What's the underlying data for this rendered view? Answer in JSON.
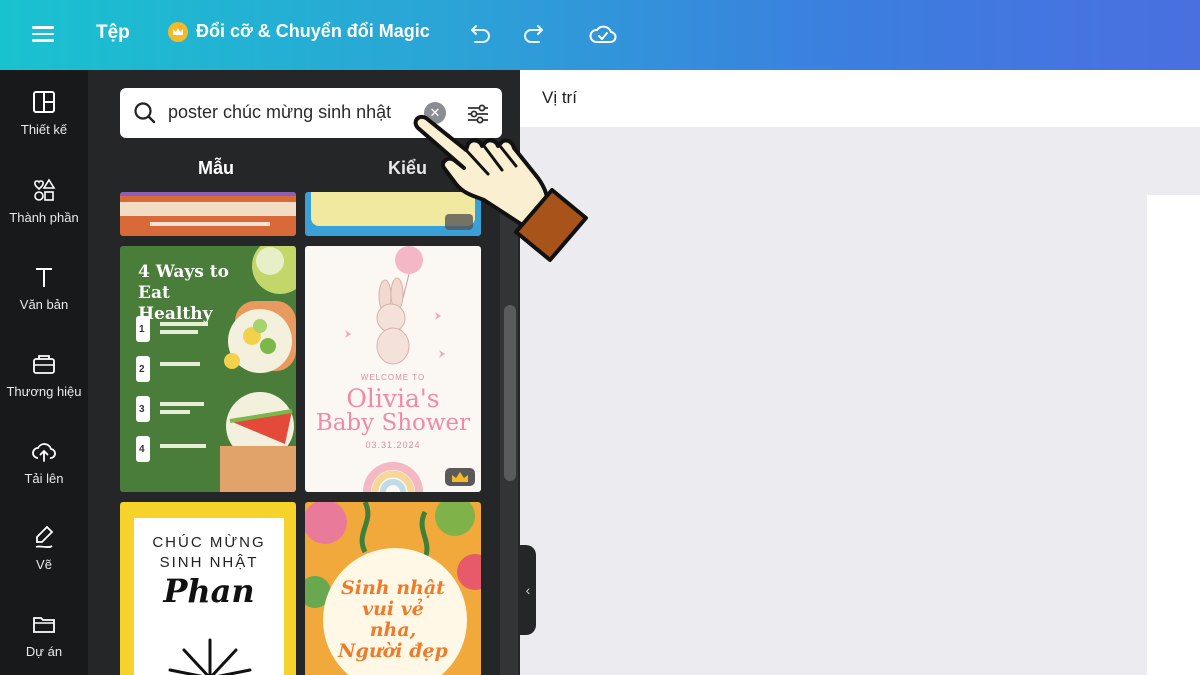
{
  "topbar": {
    "file_label": "Tệp",
    "magic_label": "Đổi cỡ & Chuyển đổi Magic",
    "gradient_start": "#19c2cf",
    "gradient_end": "#4a6fe0"
  },
  "rail": {
    "items": [
      {
        "label": "Thiết kế",
        "icon": "layout-icon"
      },
      {
        "label": "Thành phần",
        "icon": "elements-icon"
      },
      {
        "label": "Văn bản",
        "icon": "text-icon"
      },
      {
        "label": "Thương hiệu",
        "icon": "brand-icon"
      },
      {
        "label": "Tải lên",
        "icon": "upload-icon"
      },
      {
        "label": "Vẽ",
        "icon": "draw-icon"
      },
      {
        "label": "Dự án",
        "icon": "folder-icon"
      }
    ]
  },
  "panel": {
    "search_value": "poster chúc mừng sinh nhật",
    "tabs": [
      "Mẫu",
      "Kiểu"
    ]
  },
  "templates": {
    "healthy_title": "4 Ways to Eat Healthy",
    "healthy_steps": [
      "1",
      "2",
      "3",
      "4"
    ],
    "shower_welcome": "WELCOME TO",
    "shower_name": "Olivia's",
    "shower_title": "Baby Shower",
    "shower_date": "03.31.2024",
    "birthday_line1": "CHÚC MỪNG",
    "birthday_line2": "SINH NHẬT",
    "birthday_name": "Phan",
    "floral_text": [
      "Sinh nhật",
      "vui vẻ",
      "nha,",
      "Người đẹp"
    ]
  },
  "canvas": {
    "position_label": "Vị trí"
  }
}
